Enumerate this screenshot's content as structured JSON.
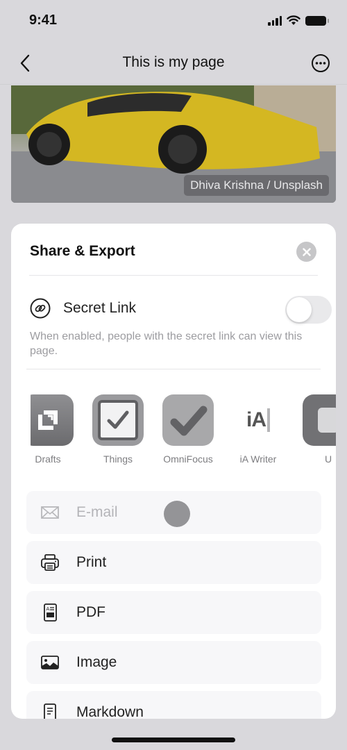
{
  "status_bar": {
    "time": "9:41",
    "icons": [
      "cellular-signal-icon",
      "wifi-icon",
      "battery-icon"
    ]
  },
  "nav": {
    "title": "This is my page",
    "back_icon": "chevron-left-icon",
    "more_icon": "ellipsis-circle-icon"
  },
  "hero": {
    "credit": "Dhiva Krishna / Unsplash"
  },
  "sheet": {
    "title": "Share & Export",
    "close_icon": "close-icon",
    "secret_link": {
      "label": "Secret Link",
      "icon": "link-icon",
      "enabled": false,
      "description": "When enabled, people with the secret link can view this page."
    },
    "apps": [
      {
        "label": "Drafts",
        "icon": "drafts-app-icon"
      },
      {
        "label": "Things",
        "icon": "things-app-icon"
      },
      {
        "label": "OmniFocus",
        "icon": "omnifocus-app-icon"
      },
      {
        "label": "iA Writer",
        "icon": "ia-writer-app-icon",
        "glyph": "iA"
      },
      {
        "label": "U",
        "icon": "ulysses-app-icon"
      }
    ],
    "export_items": [
      {
        "label": "E-mail",
        "icon": "envelope-icon",
        "disabled": true
      },
      {
        "label": "Print",
        "icon": "printer-icon",
        "disabled": false
      },
      {
        "label": "PDF",
        "icon": "pdf-document-icon",
        "disabled": false
      },
      {
        "label": "Image",
        "icon": "photo-icon",
        "disabled": false
      },
      {
        "label": "Markdown",
        "icon": "text-document-icon",
        "disabled": false
      }
    ]
  }
}
